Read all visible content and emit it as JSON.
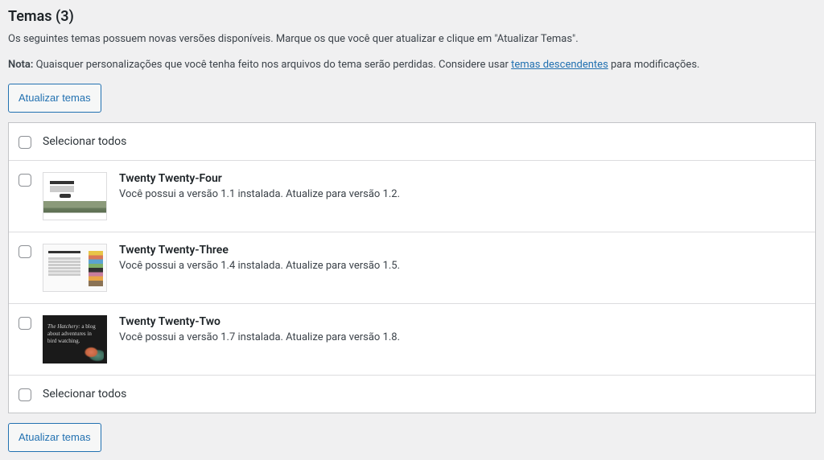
{
  "header": {
    "title": "Temas (3)"
  },
  "intro": "Os seguintes temas possuem novas versões disponíveis. Marque os que você quer atualizar e clique em \"Atualizar Temas\".",
  "note": {
    "label": "Nota:",
    "text_before": " Quaisquer personalizações que você tenha feito nos arquivos do tema serão perdidas. Considere usar ",
    "link_text": "temas descendentes",
    "text_after": " para modificações."
  },
  "buttons": {
    "update_top": "Atualizar temas",
    "update_bottom": "Atualizar temas"
  },
  "select_all": {
    "top": "Selecionar todos",
    "bottom": "Selecionar todos"
  },
  "themes": [
    {
      "name": "Twenty Twenty-Four",
      "version_text": "Você possui a versão 1.1 instalada. Atualize para versão 1.2."
    },
    {
      "name": "Twenty Twenty-Three",
      "version_text": "Você possui a versão 1.4 instalada. Atualize para versão 1.5."
    },
    {
      "name": "Twenty Twenty-Two",
      "version_text": "Você possui a versão 1.7 instalada. Atualize para versão 1.8."
    }
  ],
  "thumb_tt2": {
    "line1": "The Hatchery:",
    "line2": "a blog",
    "line3": "about adventures in",
    "line4": "bird watching."
  }
}
